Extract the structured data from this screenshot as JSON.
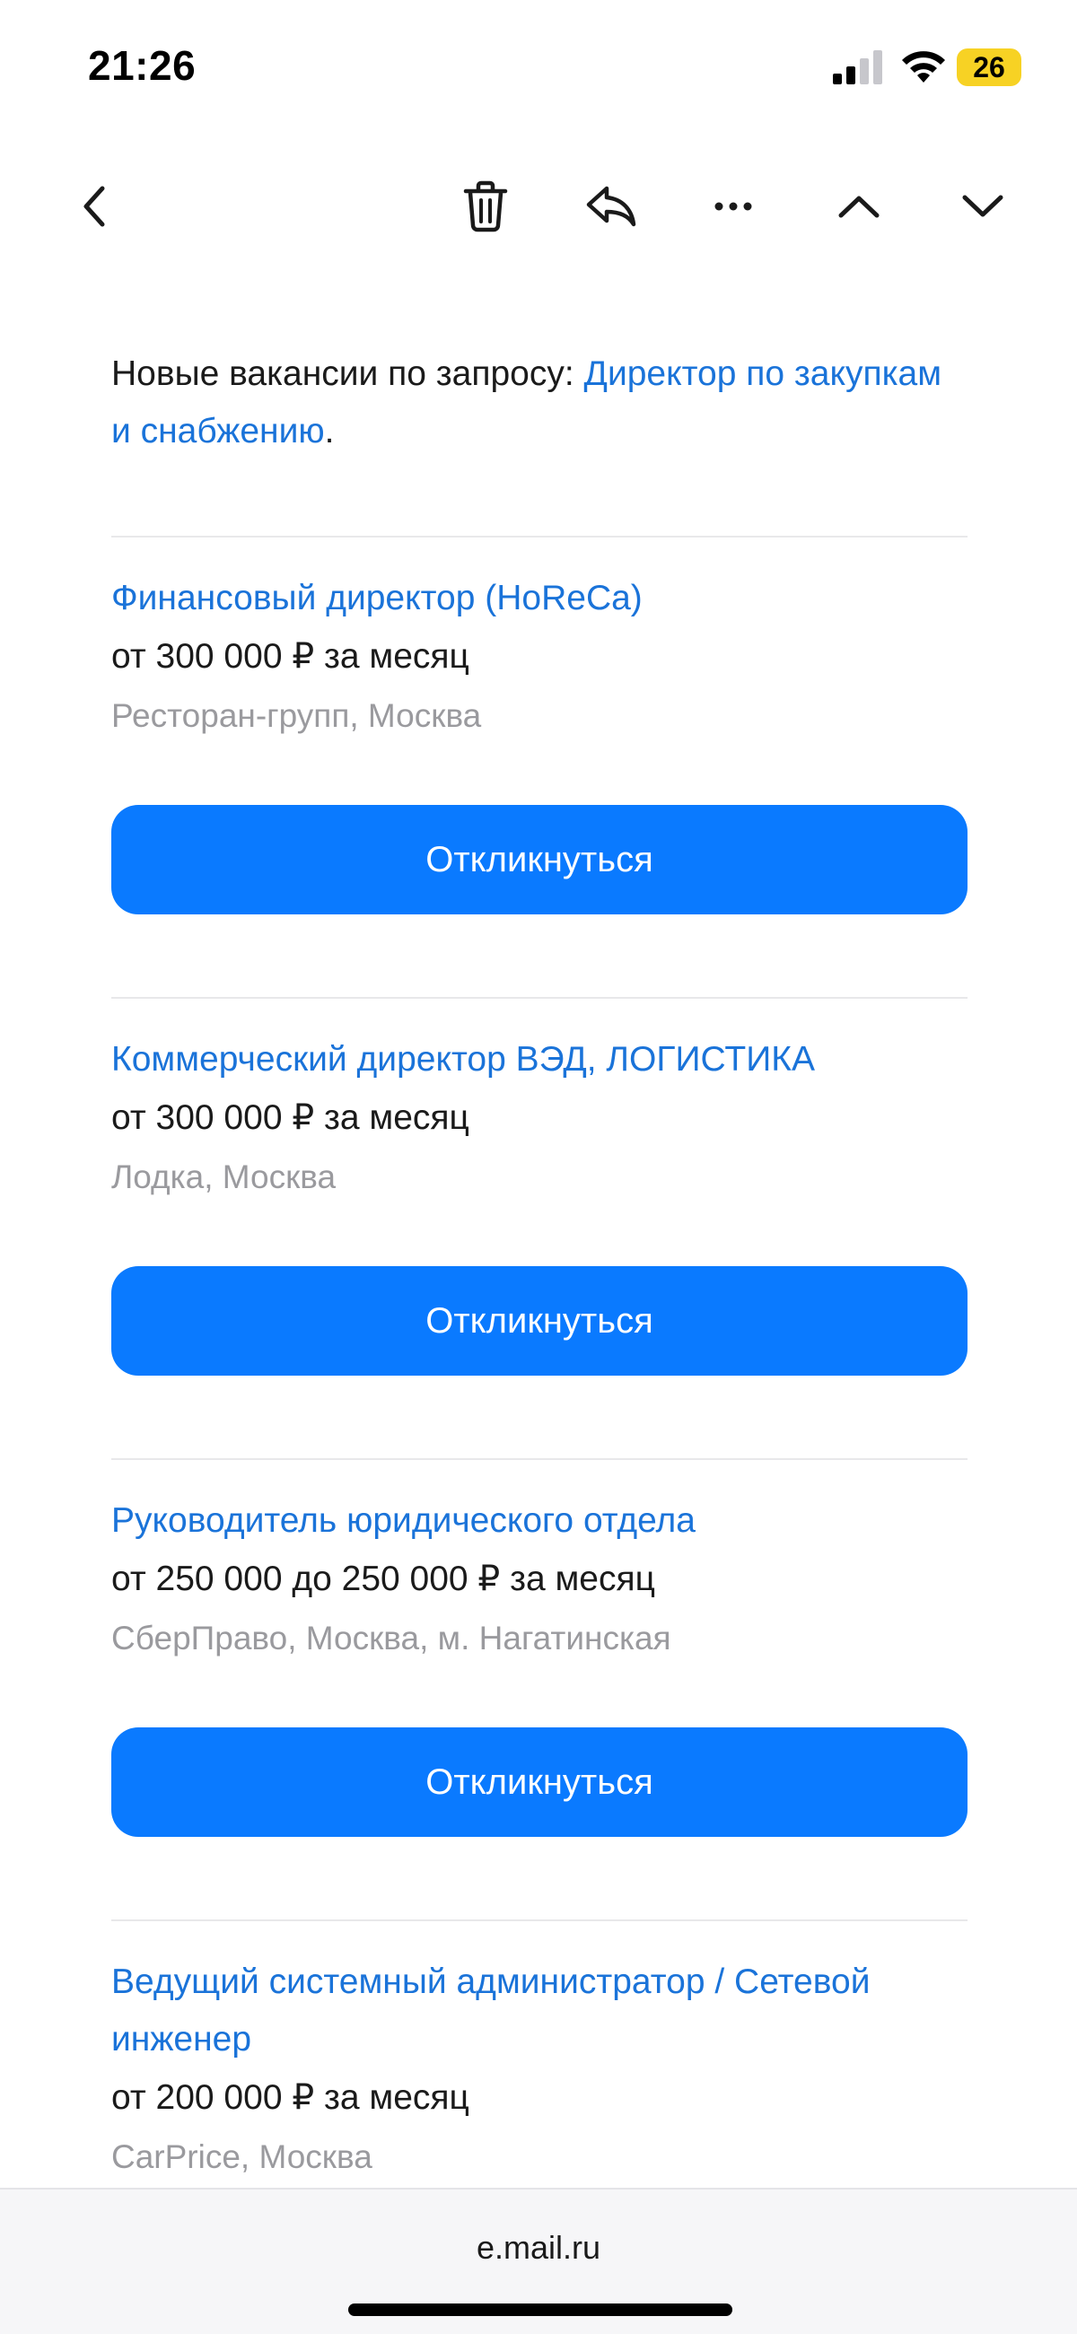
{
  "status_bar": {
    "time": "21:26",
    "battery": "26",
    "icons": [
      "signal-icon",
      "wifi-icon",
      "battery-icon"
    ]
  },
  "toolbar": {
    "icons": [
      "back-chevron-icon",
      "trash-icon",
      "reply-icon",
      "more-icon",
      "chevron-up-icon",
      "chevron-down-icon"
    ]
  },
  "intro": {
    "prefix": "Новые вакансии по запросу: ",
    "query_link": "Директор по закупкам и снабжению",
    "suffix": "."
  },
  "jobs": [
    {
      "title": "Финансовый директор (HoReCa)",
      "salary": "от 300 000 ₽ за месяц",
      "company": "Ресторан-групп, Москва",
      "button": "Откликнуться"
    },
    {
      "title": "Коммерческий директор ВЭД, ЛОГИСТИКА",
      "salary": "от 300 000 ₽ за месяц",
      "company": "Лодка, Москва",
      "button": "Откликнуться"
    },
    {
      "title": "Руководитель юридического отдела",
      "salary": "от 250 000 до 250 000 ₽ за месяц",
      "company": "СберПраво, Москва, м. Нагатинская",
      "button": "Откликнуться"
    },
    {
      "title": "Ведущий системный администратор / Сетевой инженер",
      "salary": "от 200 000 ₽ за месяц",
      "company": "CarPrice, Москва"
    }
  ],
  "bottom_bar": {
    "domain": "e.mail.ru"
  },
  "colors": {
    "link": "#1a73d9",
    "button": "#0a7aff",
    "battery": "#f7d224",
    "secondary_text": "#9a9a9e"
  }
}
